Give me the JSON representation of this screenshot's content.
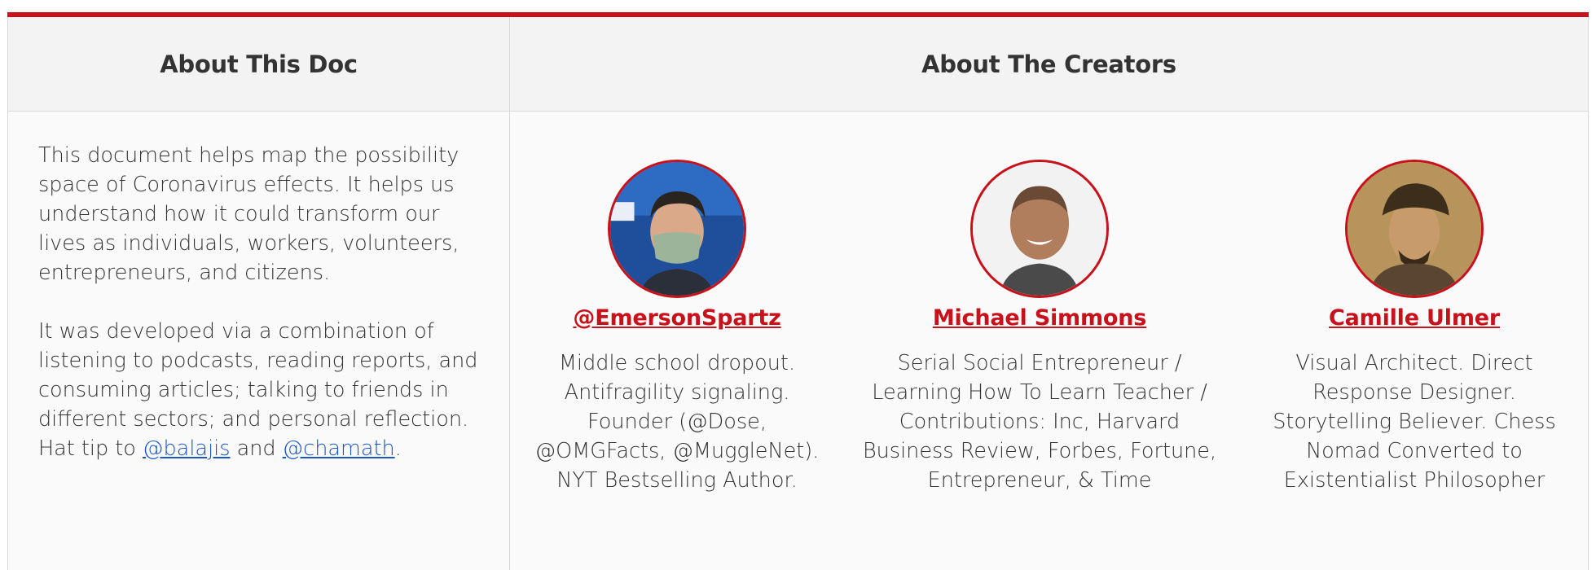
{
  "header": {
    "about_doc": "About This Doc",
    "about_creators": "About The Creators"
  },
  "doc": {
    "paragraph1": "This document helps map the possibility space of Coronavirus effects. It helps us understand how it could transform our lives as individuals, workers, volunteers, entrepreneurs, and citizens.",
    "paragraph2_before": "It was developed via a combination of listening to podcasts, reading reports, and consuming articles; talking to friends in different sectors; and personal reflection. Hat tip to ",
    "link1": "@balajis",
    "and": " and ",
    "link2": "@chamath",
    "end": "."
  },
  "creators": [
    {
      "name": "@EmersonSpartz",
      "bio": "Middle school dropout. Antifragility signaling. Founder (@Dose, @OMGFacts, @MuggleNet). NYT Bestselling Author."
    },
    {
      "name": "Michael Simmons",
      "bio": "Serial Social Entrepreneur / Learning How To Learn Teacher / Contributions: Inc, Harvard Business Review, Forbes, Fortune, Entrepreneur, & Time"
    },
    {
      "name": "Camille Ulmer",
      "bio": "Visual Architect. Direct Response Designer. Storytelling Believer.  Chess Nomad Converted to Existentialist Philosopher"
    }
  ],
  "colors": {
    "accent": "#c8111a",
    "link": "#1a56c4",
    "header_bg": "#f3f3f3",
    "cell_bg": "#fafafa",
    "border": "#d9d9d9"
  }
}
